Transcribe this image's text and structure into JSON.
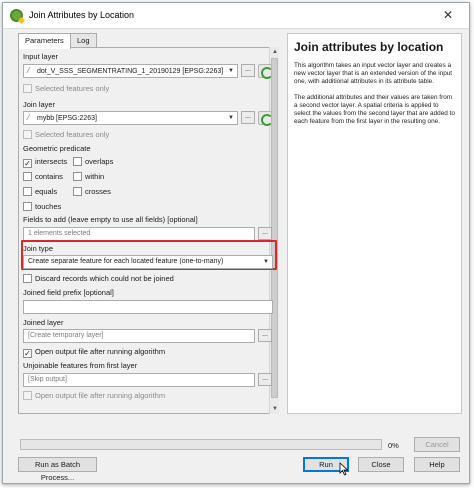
{
  "window": {
    "title": "Join Attributes by Location",
    "close_glyph": "✕"
  },
  "tabs": [
    {
      "label": "Parameters",
      "active": true
    },
    {
      "label": "Log",
      "active": false
    }
  ],
  "params": {
    "input_layer_label": "Input layer",
    "input_layer_value": "dot_V_SSS_SEGMENTRATING_1_20190129 [EPSG:2263]",
    "input_selected_only": "Selected features only",
    "join_layer_label": "Join layer",
    "join_layer_value": "mybb [EPSG:2263]",
    "join_selected_only": "Selected features only",
    "geometric_predicate_label": "Geometric predicate",
    "predicates": [
      {
        "label": "intersects",
        "checked": true
      },
      {
        "label": "overlaps",
        "checked": false
      },
      {
        "label": "contains",
        "checked": false
      },
      {
        "label": "within",
        "checked": false
      },
      {
        "label": "equals",
        "checked": false
      },
      {
        "label": "crosses",
        "checked": false
      },
      {
        "label": "touches",
        "checked": false
      }
    ],
    "fields_label": "Fields to add (leave empty to use all fields) [optional]",
    "fields_value": "1 elements selected",
    "join_type_label": "Join type",
    "join_type_value": "Create separate feature for each located feature (one-to-many)",
    "discard_label": "Discard records which could not be joined",
    "prefix_label": "Joined field prefix [optional]",
    "prefix_value": "",
    "joined_layer_label": "Joined layer",
    "joined_layer_placeholder": "[Create temporary layer]",
    "open_output_label": "Open output file after running algorithm",
    "unjoinable_label": "Unjoinable features from first layer",
    "unjoinable_placeholder": "[Skip output]",
    "open_output2_label": "Open output file after running algorithm",
    "dots": "..."
  },
  "help": {
    "title": "Join attributes by location",
    "p1": "This algorithm takes an input vector layer and creates a new vector layer that is an extended version of the input one, with additional attributes in its attribute table.",
    "p2": "The additional attributes and their values are taken from a second vector layer. A spatial criteria is applied to select the values from the second layer that are added to each feature from the first layer in the resulting one."
  },
  "footer": {
    "progress_percent": 0,
    "progress_text": "0%",
    "cancel": "Cancel",
    "batch": "Run as Batch Process...",
    "run": "Run",
    "close": "Close",
    "help": "Help"
  },
  "colors": {
    "highlight": "#d9272e",
    "progress": "#06b025",
    "qgis_green": "#6aa83f"
  },
  "icons": [
    "qgis-logo-icon",
    "close-icon",
    "vector-layer-icon",
    "chevron-down-icon",
    "iterate-icon",
    "checkmark-icon",
    "scroll-up-icon",
    "scroll-down-icon",
    "mouse-cursor-icon"
  ]
}
